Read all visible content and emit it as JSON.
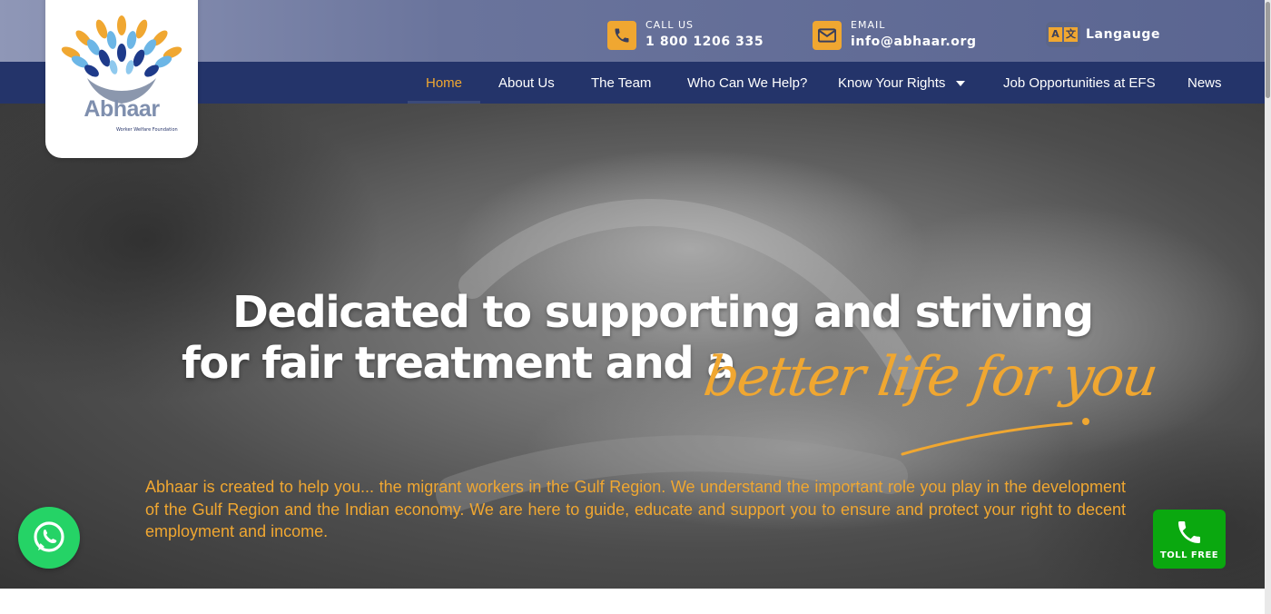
{
  "header": {
    "call": {
      "label": "CALL US",
      "value": "1 800 1206 335",
      "icon": "phone-icon"
    },
    "email": {
      "label": "EMAIL",
      "value": "info@abhaar.org",
      "icon": "envelope-icon"
    },
    "language": {
      "label": "Langauge",
      "icon": "translate-icon",
      "glyph_a": "A",
      "glyph_b": "文"
    }
  },
  "logo": {
    "name": "Abhaar",
    "tagline": "Worker Welfare Foundation"
  },
  "nav": {
    "items": [
      {
        "label": "Home",
        "active": true
      },
      {
        "label": "About Us"
      },
      {
        "label": "The Team"
      },
      {
        "label": "Who Can We Help?"
      },
      {
        "label": "Know Your Rights",
        "dropdown": true
      },
      {
        "label": "Job Opportunities at EFS"
      },
      {
        "label": "News"
      }
    ]
  },
  "hero": {
    "line1": "Dedicated to supporting and striving",
    "line2": "for fair treatment and a",
    "highlight": "better life for you",
    "paragraph": "Abhaar is created to help you... the migrant workers in the Gulf Region. We understand the important role you play in the development of the Gulf Region and the Indian economy. We are here to guide, educate and support you to ensure and protect your right to decent employment and income."
  },
  "floating": {
    "whatsapp_icon": "whatsapp-icon",
    "toll_free_label": "TOLL FREE"
  },
  "colors": {
    "accent": "#f0a731",
    "nav": "#24346a",
    "whatsapp": "#25d366",
    "toll": "#0aa80f"
  }
}
